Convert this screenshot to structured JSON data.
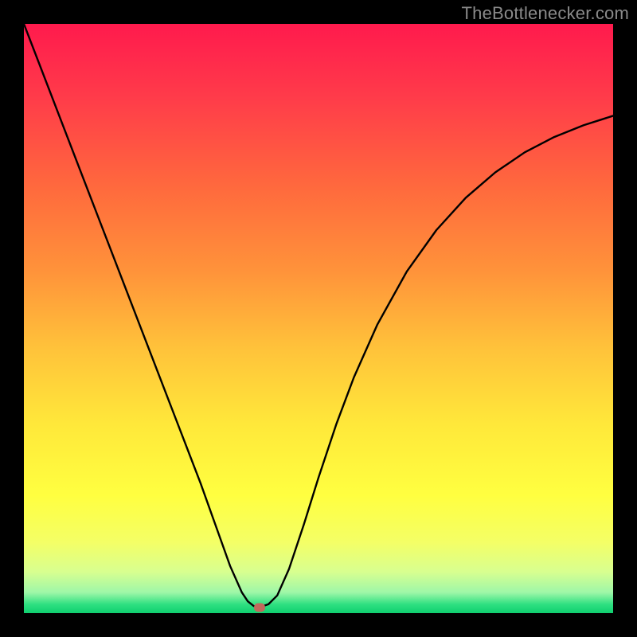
{
  "watermark": "TheBottlenecker.com",
  "chart_data": {
    "type": "line",
    "title": "",
    "xlabel": "",
    "ylabel": "",
    "xlim": [
      0,
      1
    ],
    "ylim": [
      0,
      1
    ],
    "grid": false,
    "series": [
      {
        "name": "bottleneck-curve",
        "x": [
          0.0,
          0.025,
          0.05,
          0.075,
          0.1,
          0.125,
          0.15,
          0.175,
          0.2,
          0.225,
          0.25,
          0.275,
          0.3,
          0.325,
          0.35,
          0.37,
          0.38,
          0.39,
          0.4,
          0.415,
          0.43,
          0.45,
          0.475,
          0.5,
          0.53,
          0.56,
          0.6,
          0.65,
          0.7,
          0.75,
          0.8,
          0.85,
          0.9,
          0.95,
          1.0
        ],
        "y": [
          1.0,
          0.935,
          0.87,
          0.805,
          0.74,
          0.675,
          0.61,
          0.545,
          0.48,
          0.415,
          0.35,
          0.285,
          0.22,
          0.15,
          0.08,
          0.035,
          0.02,
          0.012,
          0.01,
          0.015,
          0.03,
          0.075,
          0.15,
          0.23,
          0.32,
          0.4,
          0.49,
          0.58,
          0.65,
          0.705,
          0.748,
          0.782,
          0.808,
          0.828,
          0.844
        ]
      }
    ],
    "marker": {
      "x": 0.4,
      "y": 0.01,
      "color": "#c16a5c"
    },
    "background_gradient": {
      "stops": [
        {
          "offset": 0.0,
          "color": "#ff1a4d"
        },
        {
          "offset": 0.12,
          "color": "#ff3a4a"
        },
        {
          "offset": 0.28,
          "color": "#ff6a3d"
        },
        {
          "offset": 0.42,
          "color": "#ff933a"
        },
        {
          "offset": 0.55,
          "color": "#ffc23a"
        },
        {
          "offset": 0.68,
          "color": "#ffe83a"
        },
        {
          "offset": 0.8,
          "color": "#ffff40"
        },
        {
          "offset": 0.88,
          "color": "#f4ff66"
        },
        {
          "offset": 0.93,
          "color": "#d8ff90"
        },
        {
          "offset": 0.965,
          "color": "#9ef7a8"
        },
        {
          "offset": 0.985,
          "color": "#2fe081"
        },
        {
          "offset": 1.0,
          "color": "#0fcf6f"
        }
      ]
    }
  }
}
